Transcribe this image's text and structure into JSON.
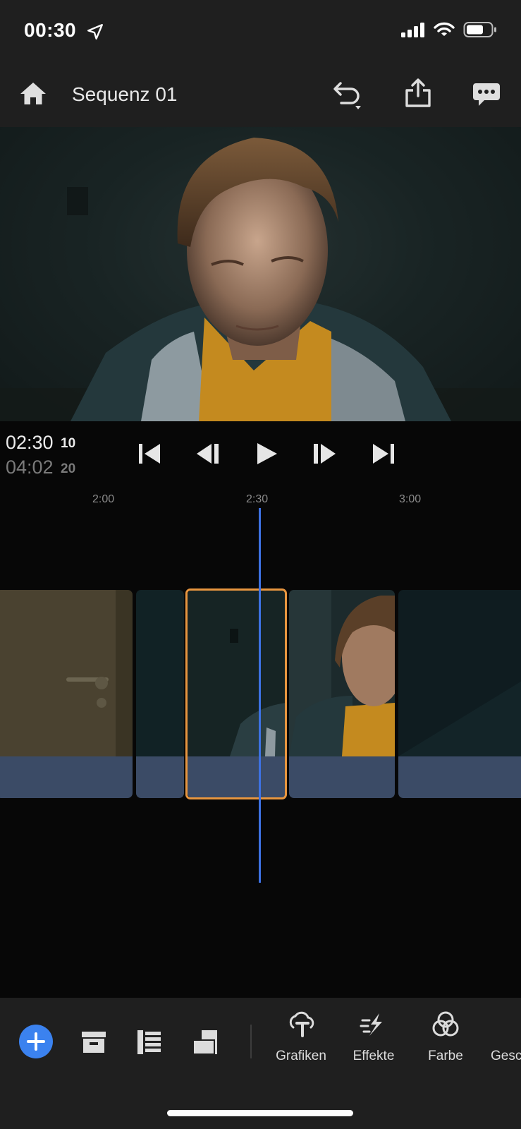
{
  "status_bar": {
    "time": "00:30",
    "icons": [
      "location-arrow-icon",
      "cellular-signal-icon",
      "wifi-icon",
      "battery-icon"
    ]
  },
  "header": {
    "title": "Sequenz 01",
    "icons": [
      "home-icon",
      "undo-icon",
      "share-icon",
      "comments-icon"
    ]
  },
  "preview": {
    "description_icon": "video-frame"
  },
  "transport": {
    "current_time": "02:30",
    "current_frames": "10",
    "total_time": "04:02",
    "total_frames": "20",
    "buttons": [
      "skip-to-start-icon",
      "step-back-icon",
      "play-icon",
      "step-forward-icon",
      "skip-to-end-icon"
    ]
  },
  "timeline": {
    "ticks": [
      "2:00",
      "2:30",
      "3:00"
    ],
    "accent_playhead": "#3d72e3",
    "accent_selection": "#e8963f",
    "audio_bar_color": "#3b4b66"
  },
  "toolbar": {
    "add_icon": "plus-icon",
    "tools": [
      {
        "label": "Grafiken",
        "icon": "graphics-icon"
      },
      {
        "label": "Effekte",
        "icon": "effects-icon"
      },
      {
        "label": "Farbe",
        "icon": "color-icon"
      },
      {
        "label": "Gesc",
        "icon": "speed-icon"
      }
    ],
    "accent_add": "#3b82ef"
  }
}
